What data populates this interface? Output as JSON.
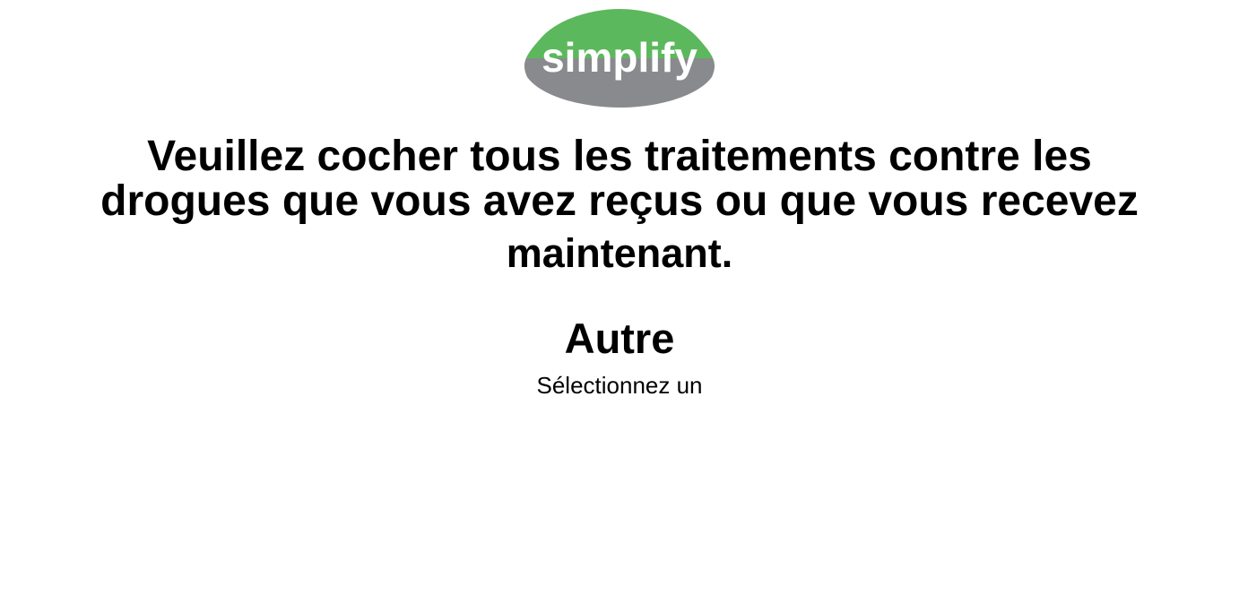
{
  "brand": {
    "logo_text": "simplify",
    "colors": {
      "green": "#5cb85c",
      "gray": "#898a8d",
      "text": "#ffffff"
    }
  },
  "question": {
    "line1": "Veuillez cocher tous les traitements contre les",
    "line2": "drogues que vous avez reçus ou que vous recevez",
    "line3": "maintenant."
  },
  "category": {
    "title": "Autre"
  },
  "selector": {
    "prompt": "Sélectionnez un"
  }
}
